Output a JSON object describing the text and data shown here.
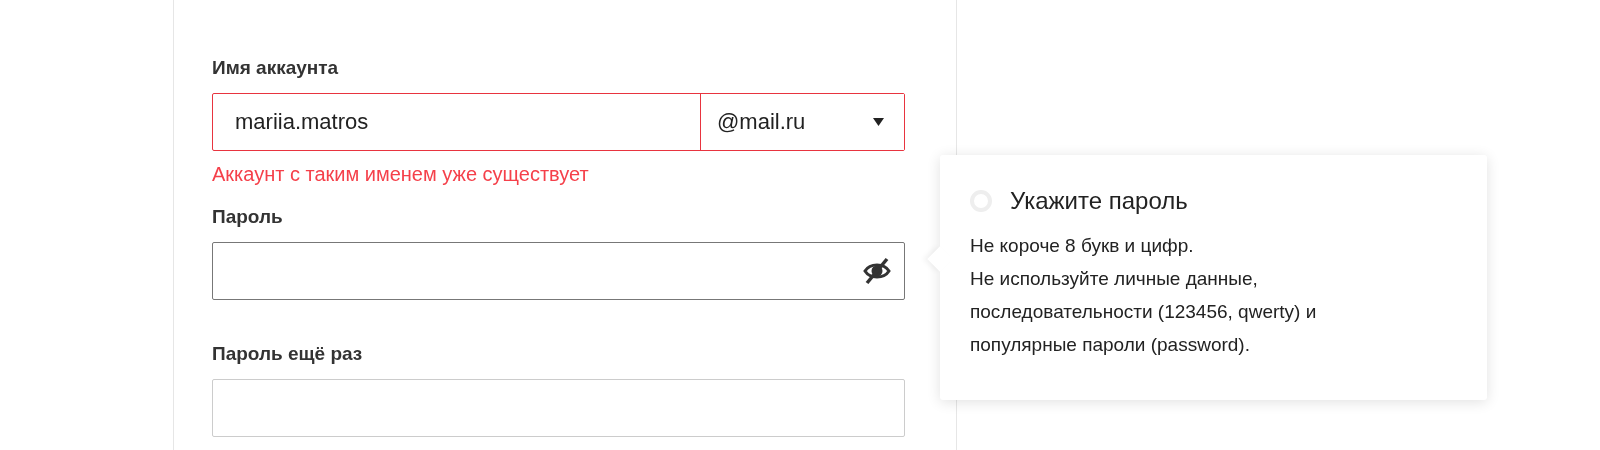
{
  "account": {
    "label": "Имя аккаунта",
    "value": "mariia.matros",
    "domain": "@mail.ru",
    "invalid": true,
    "error": "Аккаунт с таким именем уже существует"
  },
  "password": {
    "label": "Пароль"
  },
  "password_repeat": {
    "label": "Пароль ещё раз"
  },
  "hint": {
    "title": "Укажите пароль",
    "met": false,
    "lines": [
      "Не короче 8 букв и цифр.",
      "Не используйте личные данные, последовательности (123456, qwerty) и популярные пароли (password)."
    ]
  }
}
